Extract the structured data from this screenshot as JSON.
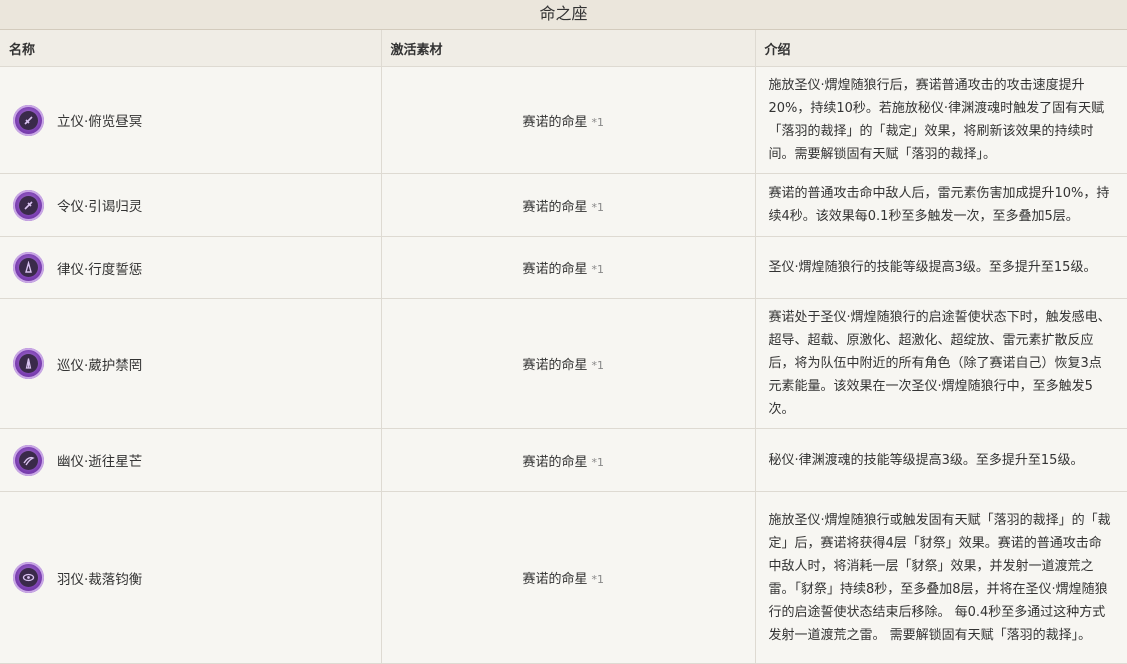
{
  "page_title": "命之座",
  "columns": [
    "名称",
    "激活素材",
    "介绍"
  ],
  "rows": [
    {
      "name": "立仪·俯览昼冥",
      "icon": "constellation-1-icon",
      "material": "赛诺的命星",
      "qty": "*1",
      "desc": "施放圣仪·煟煌随狼行后，赛诺普通攻击的攻击速度提升20%，持续10秒。若施放秘仪·律渊渡魂时触发了固有天赋「落羽的裁择」的「裁定」效果，将刷新该效果的持续时间。需要解锁固有天赋「落羽的裁择」。"
    },
    {
      "name": "令仪·引谒归灵",
      "icon": "constellation-2-icon",
      "material": "赛诺的命星",
      "qty": "*1",
      "desc": "赛诺的普通攻击命中敌人后，雷元素伤害加成提升10%，持续4秒。该效果每0.1秒至多触发一次，至多叠加5层。"
    },
    {
      "name": "律仪·行度誓惩",
      "icon": "constellation-3-icon",
      "material": "赛诺的命星",
      "qty": "*1",
      "desc": "圣仪·煟煌随狼行的技能等级提高3级。至多提升至15级。"
    },
    {
      "name": "巡仪·葳护禁罔",
      "icon": "constellation-4-icon",
      "material": "赛诺的命星",
      "qty": "*1",
      "desc": "赛诺处于圣仪·煟煌随狼行的启途誓使状态下时，触发感电、超导、超载、原激化、超激化、超绽放、雷元素扩散反应后，将为队伍中附近的所有角色（除了赛诺自己）恢复3点元素能量。该效果在一次圣仪·煟煌随狼行中，至多触发5次。"
    },
    {
      "name": "幽仪·逝往星芒",
      "icon": "constellation-5-icon",
      "material": "赛诺的命星",
      "qty": "*1",
      "desc": "秘仪·律渊渡魂的技能等级提高3级。至多提升至15级。"
    },
    {
      "name": "羽仪·裁落钧衡",
      "icon": "constellation-6-icon",
      "material": "赛诺的命星",
      "qty": "*1",
      "desc": "施放圣仪·煟煌随狼行或触发固有天赋「落羽的裁择」的「裁定」后，赛诺将获得4层「豺祭」效果。赛诺的普通攻击命中敌人时，将消耗一层「豺祭」效果，并发射一道渡荒之雷。「豺祭」持续8秒，至多叠加8层，并将在圣仪·煟煌随狼行的启途誓使状态结束后移除。 每0.4秒至多通过这种方式发射一道渡荒之雷。 需要解锁固有天赋「落羽的裁择」。"
    }
  ]
}
